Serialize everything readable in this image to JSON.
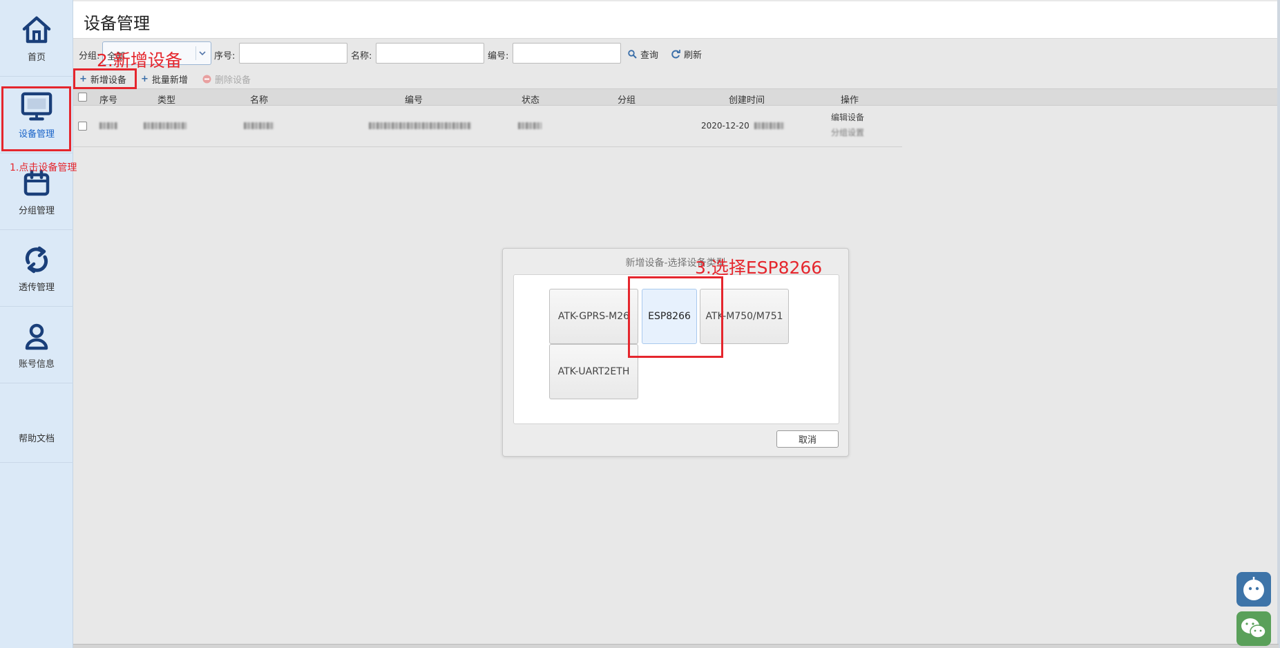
{
  "sidebar": {
    "items": [
      {
        "label": "首页"
      },
      {
        "label": "设备管理"
      },
      {
        "label": "分组管理"
      },
      {
        "label": "透传管理"
      },
      {
        "label": "账号信息"
      }
    ],
    "help_label": "帮助文档"
  },
  "annotations": {
    "step1": "1.点击设备管理",
    "step2": "2.新增设备",
    "step3": "3.选择ESP8266",
    "color": "#e5262d"
  },
  "header": {
    "title": "设备管理"
  },
  "filters": {
    "group_label": "分组:",
    "group_value": "全部",
    "seq_label": "序号:",
    "name_label": "名称:",
    "code_label": "编号:",
    "query_label": "查询",
    "refresh_label": "刷新"
  },
  "toolbar": {
    "add_label": "新增设备",
    "batch_add_label": "批量新增",
    "delete_label": "删除设备"
  },
  "table": {
    "columns": [
      "序号",
      "类型",
      "名称",
      "编号",
      "状态",
      "分组",
      "创建时间",
      "操作"
    ],
    "rows": [
      {
        "created_prefix": "2020-12-20",
        "actions": [
          "编辑设备",
          "分组设置"
        ]
      }
    ]
  },
  "dialog": {
    "title": "新增设备-选择设备类型",
    "options": [
      "ATK-GPRS-M26",
      "ESP8266",
      "ATK-M750/M751",
      "ATK-UART2ETH"
    ],
    "selected": "ESP8266",
    "cancel_label": "取消"
  },
  "colors": {
    "sidebar_bg": "#dbe9f7",
    "brand": "#1a3f7a",
    "active_text": "#1a64c8",
    "chat_bg": "#3e74a8",
    "wechat_bg": "#5aa05a"
  }
}
